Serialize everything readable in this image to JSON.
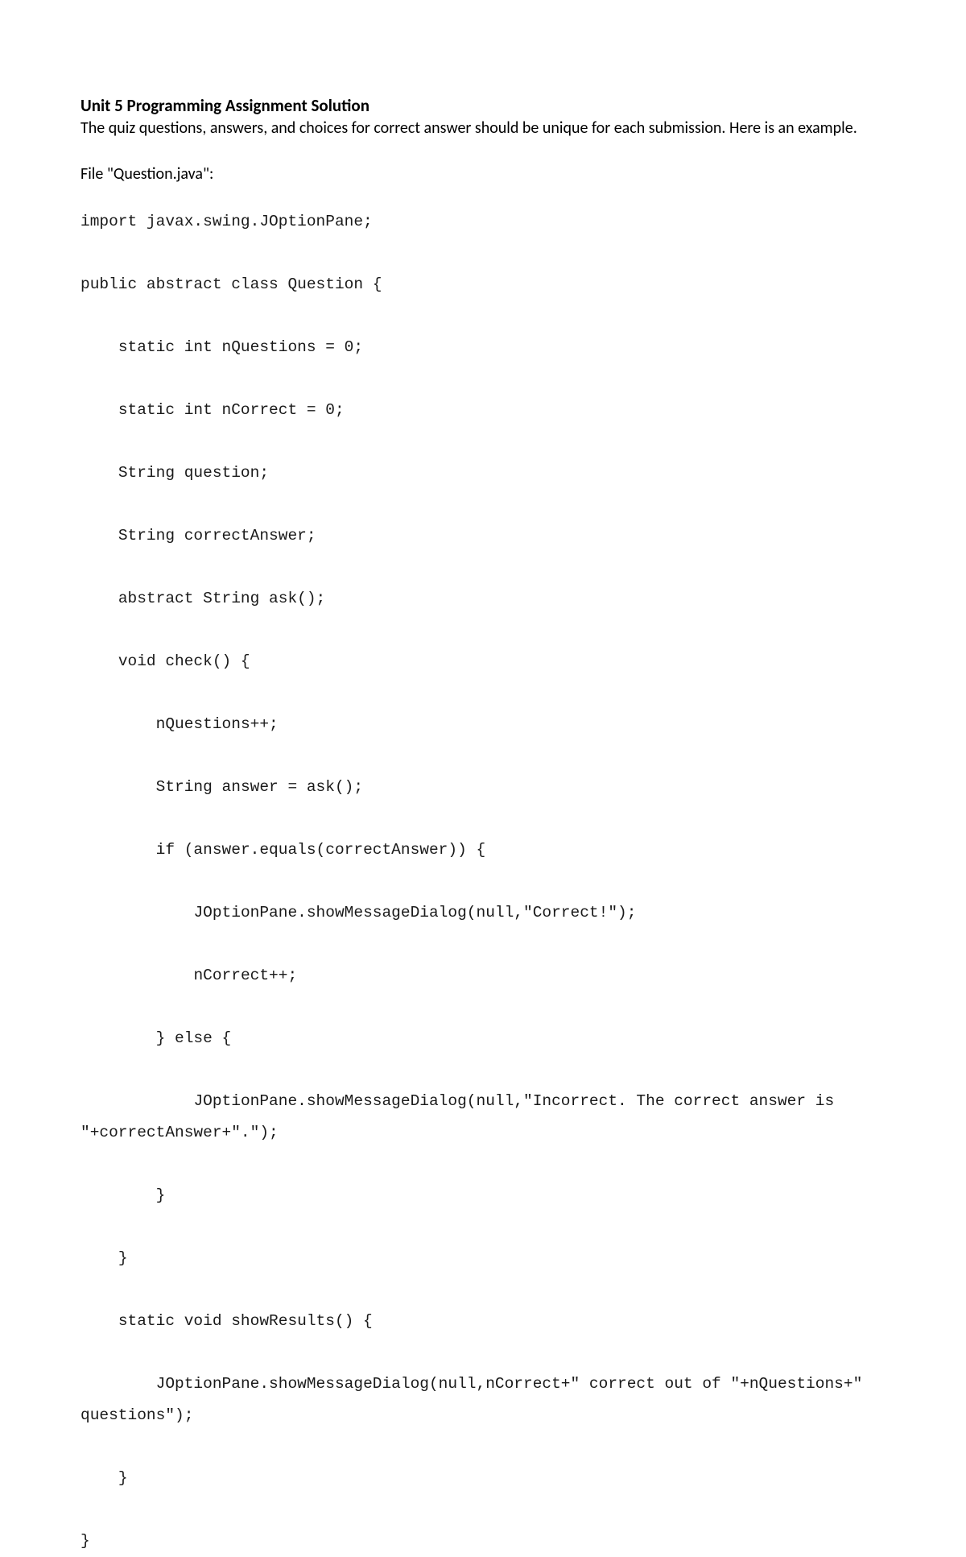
{
  "title": "Unit 5 Programming Assignment Solution",
  "description": "The quiz questions, answers, and choices for correct answer should be unique for each submission. Here is an example.",
  "file_label": "File \"Question.java\":",
  "code": "import javax.swing.JOptionPane;\n\npublic abstract class Question {\n\n    static int nQuestions = 0;\n\n    static int nCorrect = 0;\n\n    String question;\n\n    String correctAnswer;\n\n    abstract String ask();\n\n    void check() {\n\n        nQuestions++;\n\n        String answer = ask();\n\n        if (answer.equals(correctAnswer)) {\n\n            JOptionPane.showMessageDialog(null,\"Correct!\");\n\n            nCorrect++;\n\n        } else {\n\n            JOptionPane.showMessageDialog(null,\"Incorrect. The correct answer is \"+correctAnswer+\".\");\n\n        }\n\n    }\n\n    static void showResults() {\n\n        JOptionPane.showMessageDialog(null,nCorrect+\" correct out of \"+nQuestions+\" questions\");\n\n    }\n\n}"
}
